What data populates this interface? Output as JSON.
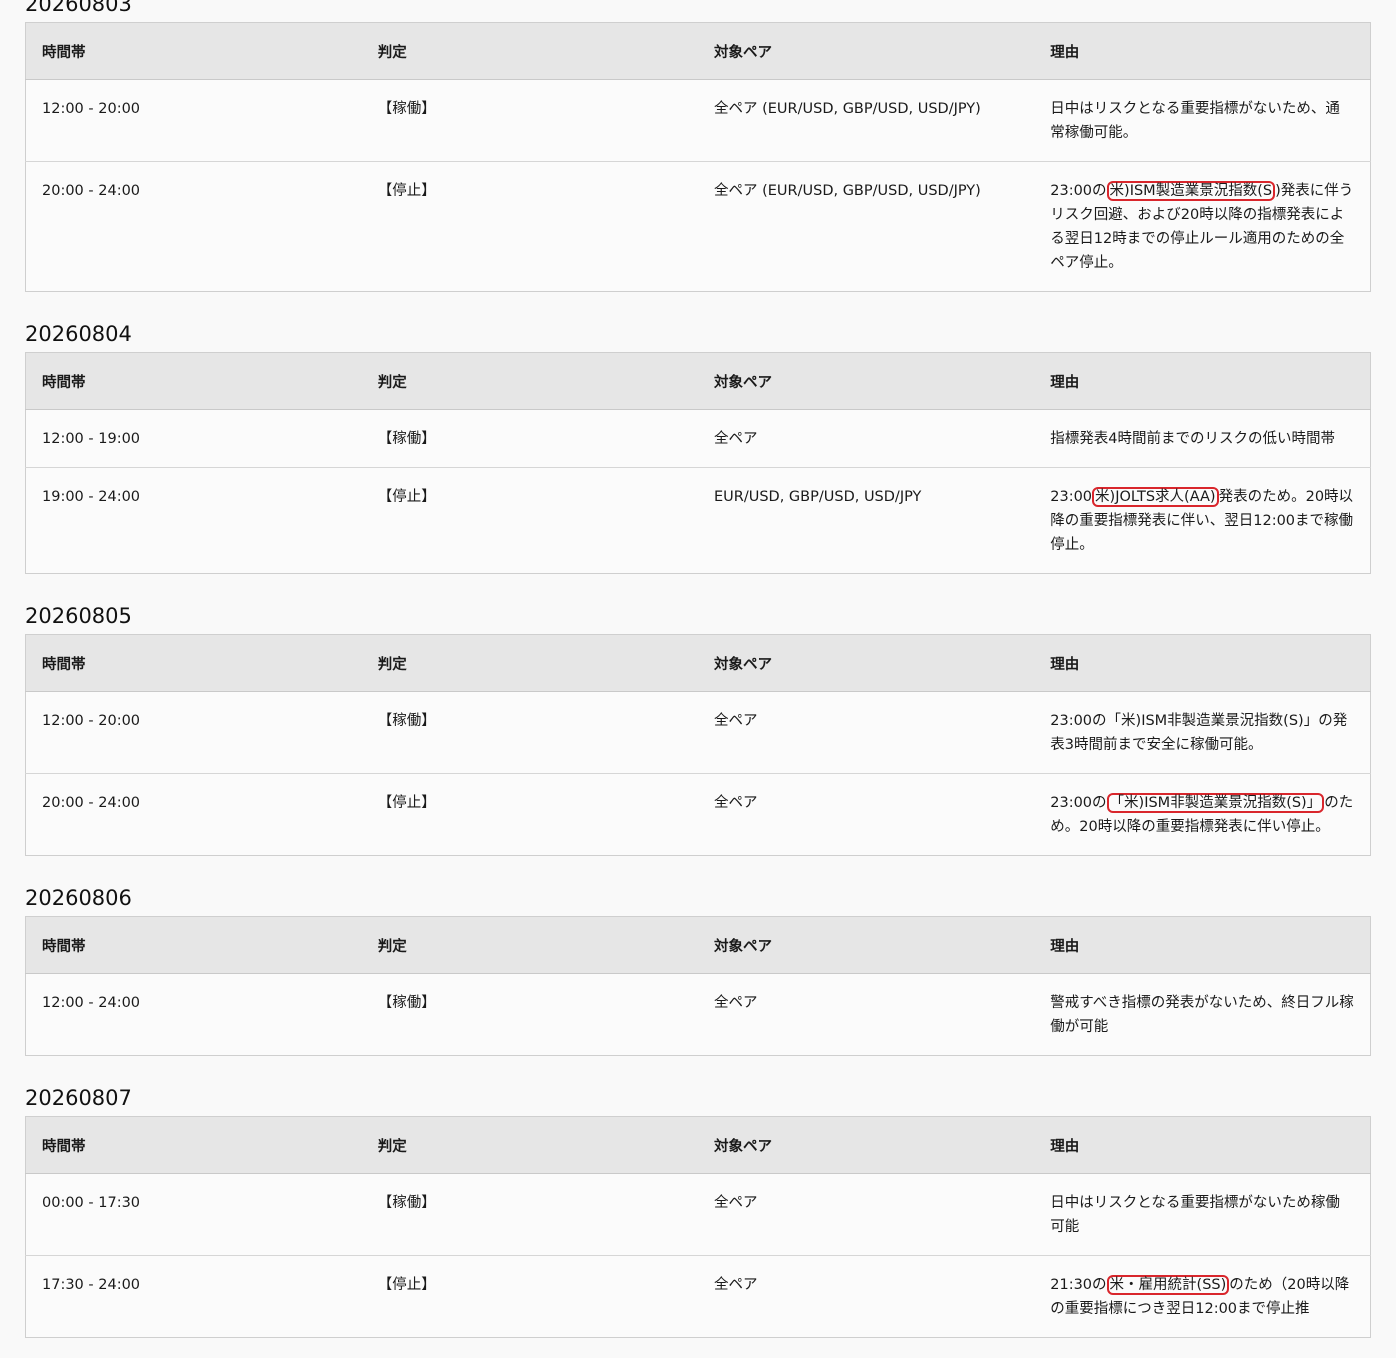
{
  "headers": {
    "time": "時間帯",
    "judge": "判定",
    "pair": "対象ペア",
    "reason": "理由"
  },
  "days": [
    {
      "date": "20260803",
      "rows": [
        {
          "time": "12:00 - 20:00",
          "status": "【稼働】",
          "pairs": "全ペア (EUR/USD, GBP/USD, USD/JPY)",
          "reason_pre": "日中はリスクとなる重要指標がないため、通常稼働可能。",
          "reason_hl": "",
          "reason_post": ""
        },
        {
          "time": "20:00 - 24:00",
          "status": "【停止】",
          "pairs": "全ペア (EUR/USD, GBP/USD, USD/JPY)",
          "reason_pre": "23:00の",
          "reason_hl": "米)ISM製造業景況指数(S",
          "reason_post": ")発表に伴うリスク回避、および20時以降の指標発表による翌日12時までの停止ルール適用のための全ペア停止。"
        }
      ]
    },
    {
      "date": "20260804",
      "rows": [
        {
          "time": "12:00 - 19:00",
          "status": "【稼働】",
          "pairs": "全ペア",
          "reason_pre": "指標発表4時間前までのリスクの低い時間帯",
          "reason_hl": "",
          "reason_post": ""
        },
        {
          "time": "19:00 - 24:00",
          "status": "【停止】",
          "pairs": "EUR/USD, GBP/USD, USD/JPY",
          "reason_pre": "23:00",
          "reason_hl": "米)JOLTS求人(AA)",
          "reason_post": "発表のため。20時以降の重要指標発表に伴い、翌日12:00まで稼働停止。"
        }
      ]
    },
    {
      "date": "20260805",
      "rows": [
        {
          "time": "12:00 - 20:00",
          "status": "【稼働】",
          "pairs": "全ペア",
          "reason_pre": "23:00の「米)ISM非製造業景況指数(S)」の発表3時間前まで安全に稼働可能。",
          "reason_hl": "",
          "reason_post": ""
        },
        {
          "time": "20:00 - 24:00",
          "status": "【停止】",
          "pairs": "全ペア",
          "reason_pre": "23:00の",
          "reason_hl": "「米)ISM非製造業景況指数(S)」",
          "reason_post": "のため。20時以降の重要指標発表に伴い停止。"
        }
      ]
    },
    {
      "date": "20260806",
      "rows": [
        {
          "time": "12:00 - 24:00",
          "status": "【稼働】",
          "pairs": "全ペア",
          "reason_pre": "警戒すべき指標の発表がないため、終日フル稼働が可能",
          "reason_hl": "",
          "reason_post": ""
        }
      ]
    },
    {
      "date": "20260807",
      "rows": [
        {
          "time": "00:00 - 17:30",
          "status": "【稼働】",
          "pairs": "全ペア",
          "reason_pre": "日中はリスクとなる重要指標がないため稼働可能",
          "reason_hl": "",
          "reason_post": ""
        },
        {
          "time": "17:30 - 24:00",
          "status": "【停止】",
          "pairs": "全ペア",
          "reason_pre": "21:30の",
          "reason_hl": "米・雇用統計(SS)",
          "reason_post": "のため（20時以降の重要指標につき翌日12:00まで停止推"
        }
      ]
    }
  ]
}
